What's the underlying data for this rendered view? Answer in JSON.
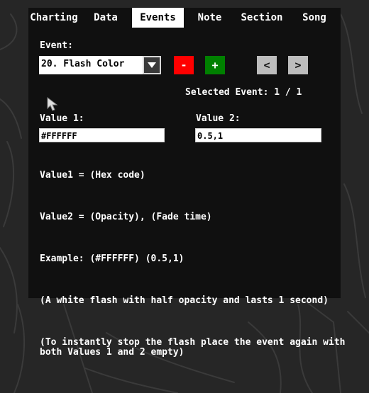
{
  "tabs": [
    "Charting",
    "Data",
    "Events",
    "Note",
    "Section",
    "Song"
  ],
  "active_tab": "Events",
  "event_label": "Event:",
  "event_select": {
    "value": "20. Flash Color"
  },
  "buttons": {
    "remove": "-",
    "add": "+",
    "prev": "<",
    "next": ">"
  },
  "selected_event": "Selected Event: 1 / 1",
  "value1": {
    "label": "Value 1:",
    "value": "#FFFFFF"
  },
  "value2": {
    "label": "Value 2:",
    "value": "0.5,1"
  },
  "description": {
    "line1": "Value1 = (Hex code)",
    "line2": "Value2 = (Opacity), (Fade time)",
    "line3": "Example: (#FFFFFF) (0.5,1)",
    "line4": "(A white flash with half opacity and lasts 1 second)",
    "line5a": "(To instantly stop the flash place the event again with",
    "line5b": "both Values 1 and 2 empty)"
  },
  "colors": {
    "remove_button": "#ff0000",
    "add_button": "#008000",
    "nav_button": "#bdbdbd",
    "panel": "#101010",
    "background": "#262626"
  },
  "icons": {
    "cursor": "arrow-cursor-icon",
    "dropdown": "chevron-down-icon"
  }
}
